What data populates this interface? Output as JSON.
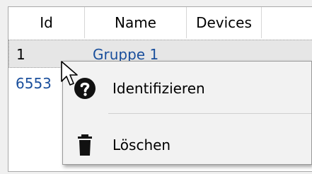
{
  "grid": {
    "columns": [
      "Id",
      "Name",
      "Devices"
    ],
    "rows": [
      {
        "id": "1",
        "name": "Gruppe 1"
      },
      {
        "id": "6553",
        "name": ""
      }
    ]
  },
  "context_menu": {
    "items": [
      {
        "label": "Identifizieren",
        "icon": "help-icon"
      },
      {
        "label": "Löschen",
        "icon": "trash-icon"
      }
    ]
  },
  "colors": {
    "link": "#1a4f9c",
    "selected_row": "#e6e6e6",
    "menu_bg": "#f2f2f2"
  }
}
